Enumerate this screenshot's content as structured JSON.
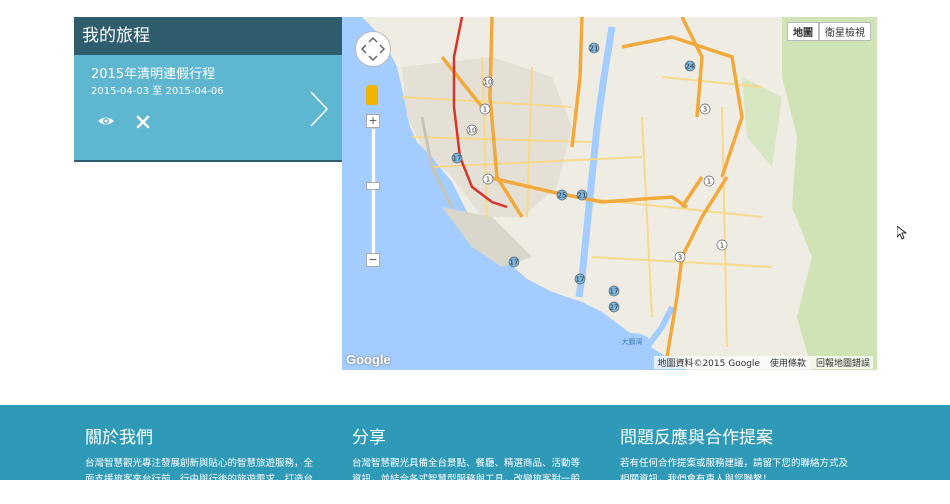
{
  "trip_panel": {
    "title": "我的旅程",
    "trip": {
      "name": "2015年清明連假行程",
      "dates": "2015-04-03 至 2015-04-06"
    }
  },
  "map": {
    "type_buttons": [
      "地圖",
      "衛星檢視"
    ],
    "active_type": "地圖",
    "zoom_plus": "+",
    "zoom_minus": "−",
    "attribution": [
      "地圖資料©2015 Google",
      "使用條款",
      "回報地圖錯誤"
    ],
    "logo": "Google",
    "road_labels": [
      "10",
      "1",
      "1",
      "1",
      "17",
      "17",
      "17",
      "17",
      "21",
      "25",
      "21",
      "24",
      "3",
      "1",
      "3",
      "1",
      "27"
    ],
    "water_label": "大鵬灣"
  },
  "footer": {
    "columns": [
      {
        "title": "關於我們",
        "text": "台灣智慧觀光專注發展創新與貼心的智慧旅遊服務，全面支援旅客來台行前、行中與行後的旅遊需求，打造台灣高"
      },
      {
        "title": "分享",
        "text": "台灣智慧觀光具備全台景點、餐廳、精選商品、活動等資訊，並結合各式智慧型服務與工具，改變旅客對一般旅遊"
      },
      {
        "title": "問題反應與合作提案",
        "text": "若有任何合作提案或服務建議，請留下您的聯絡方式及相關資訊，我們會有專人與您聯繫！"
      }
    ]
  },
  "colors": {
    "header_bg": "#2f5d6e",
    "panel_bg": "#5fb6d1",
    "footer_bg": "#2f9ab8",
    "sea": "#a3ccff",
    "road_major": "#f2a93b",
    "road_minor": "#f7d98b",
    "highway_red": "#d8342a"
  }
}
